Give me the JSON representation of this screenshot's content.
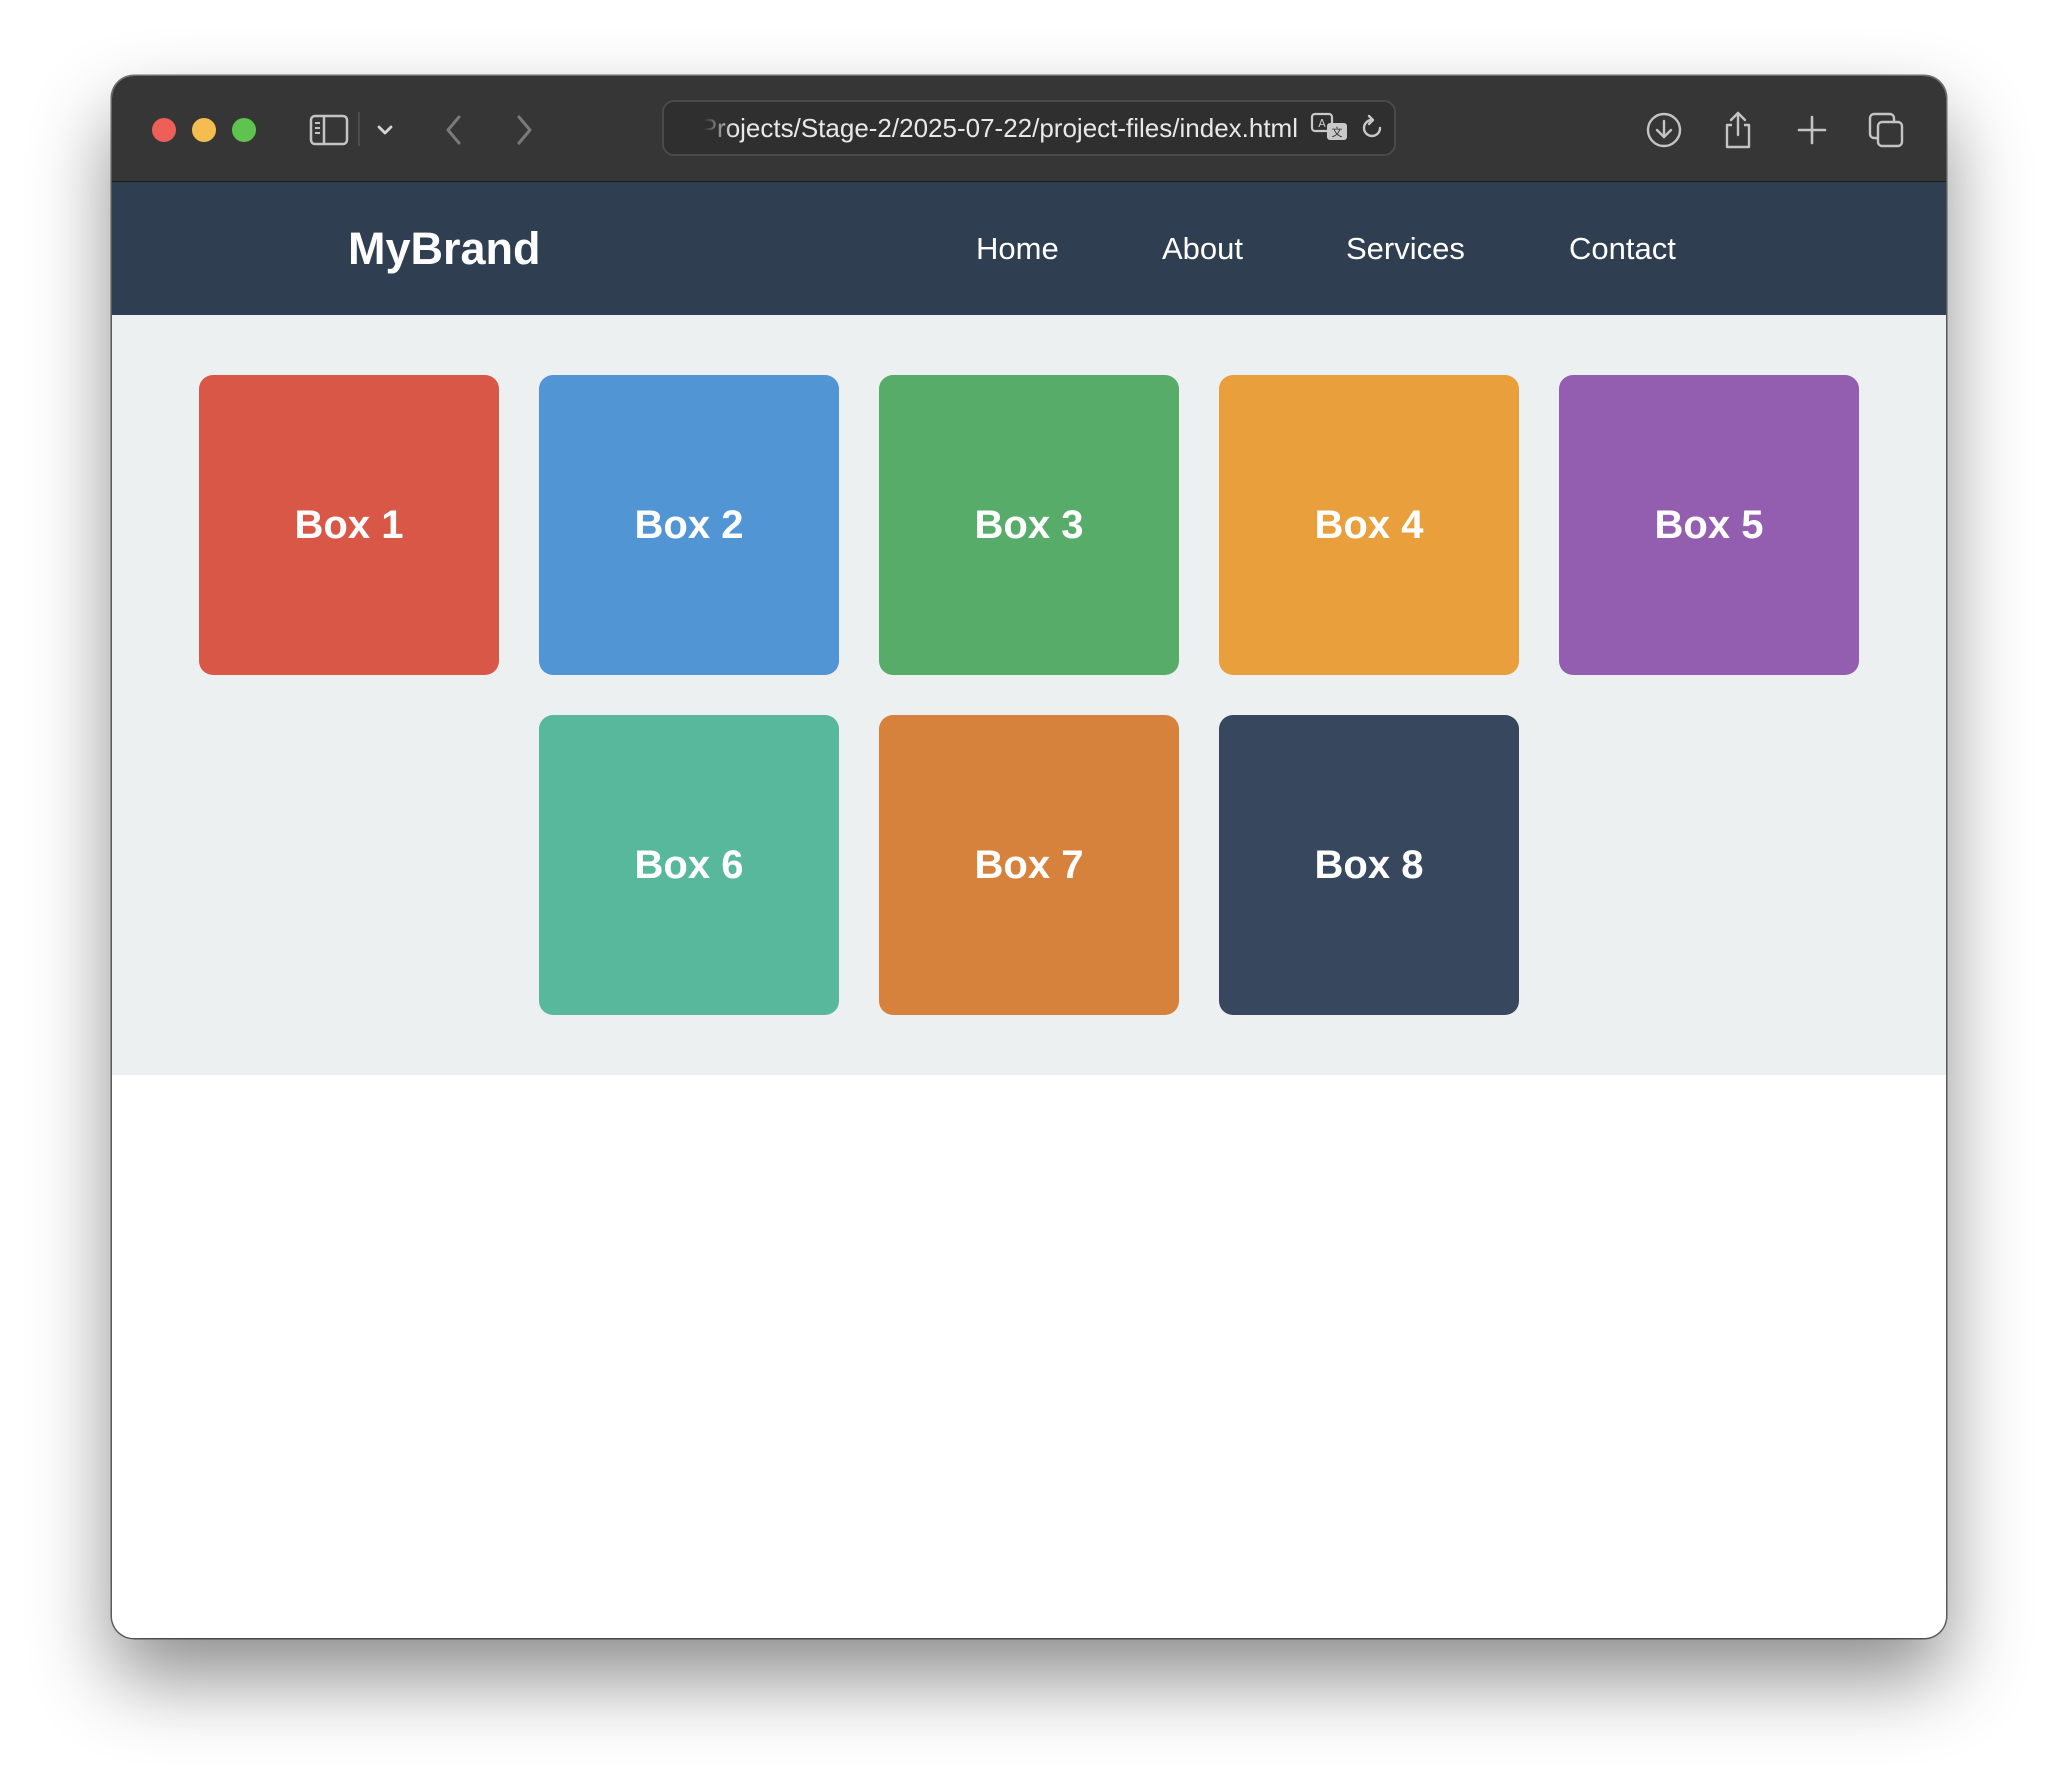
{
  "browser": {
    "url": "Projects/Stage-2/2025-07-22/project-files/index.html",
    "icons": {
      "sidebar": "sidebar-icon",
      "sidebar_menu": "chevron-down-icon",
      "back": "chevron-left-icon",
      "forward": "chevron-right-icon",
      "translate": "translate-icon",
      "reload": "reload-icon",
      "downloads": "download-icon",
      "share": "share-icon",
      "new_tab": "plus-icon",
      "tabs": "tabs-overview-icon"
    }
  },
  "nav": {
    "brand": "MyBrand",
    "links": [
      {
        "label": "Home"
      },
      {
        "label": "About"
      },
      {
        "label": "Services"
      },
      {
        "label": "Contact"
      }
    ]
  },
  "boxes": [
    {
      "label": "Box 1",
      "color": "#d95747"
    },
    {
      "label": "Box 2",
      "color": "#5195d5"
    },
    {
      "label": "Box 3",
      "color": "#56ac68"
    },
    {
      "label": "Box 4",
      "color": "#e89f3c"
    },
    {
      "label": "Box 5",
      "color": "#935db0"
    },
    {
      "label": "Box 6",
      "color": "#58b89c"
    },
    {
      "label": "Box 7",
      "color": "#d7823c"
    },
    {
      "label": "Box 8",
      "color": "#36475e"
    }
  ],
  "colors": {
    "toolbar": "#363636",
    "nav_background": "#2f3e50",
    "content_background": "#ecf0f1"
  }
}
